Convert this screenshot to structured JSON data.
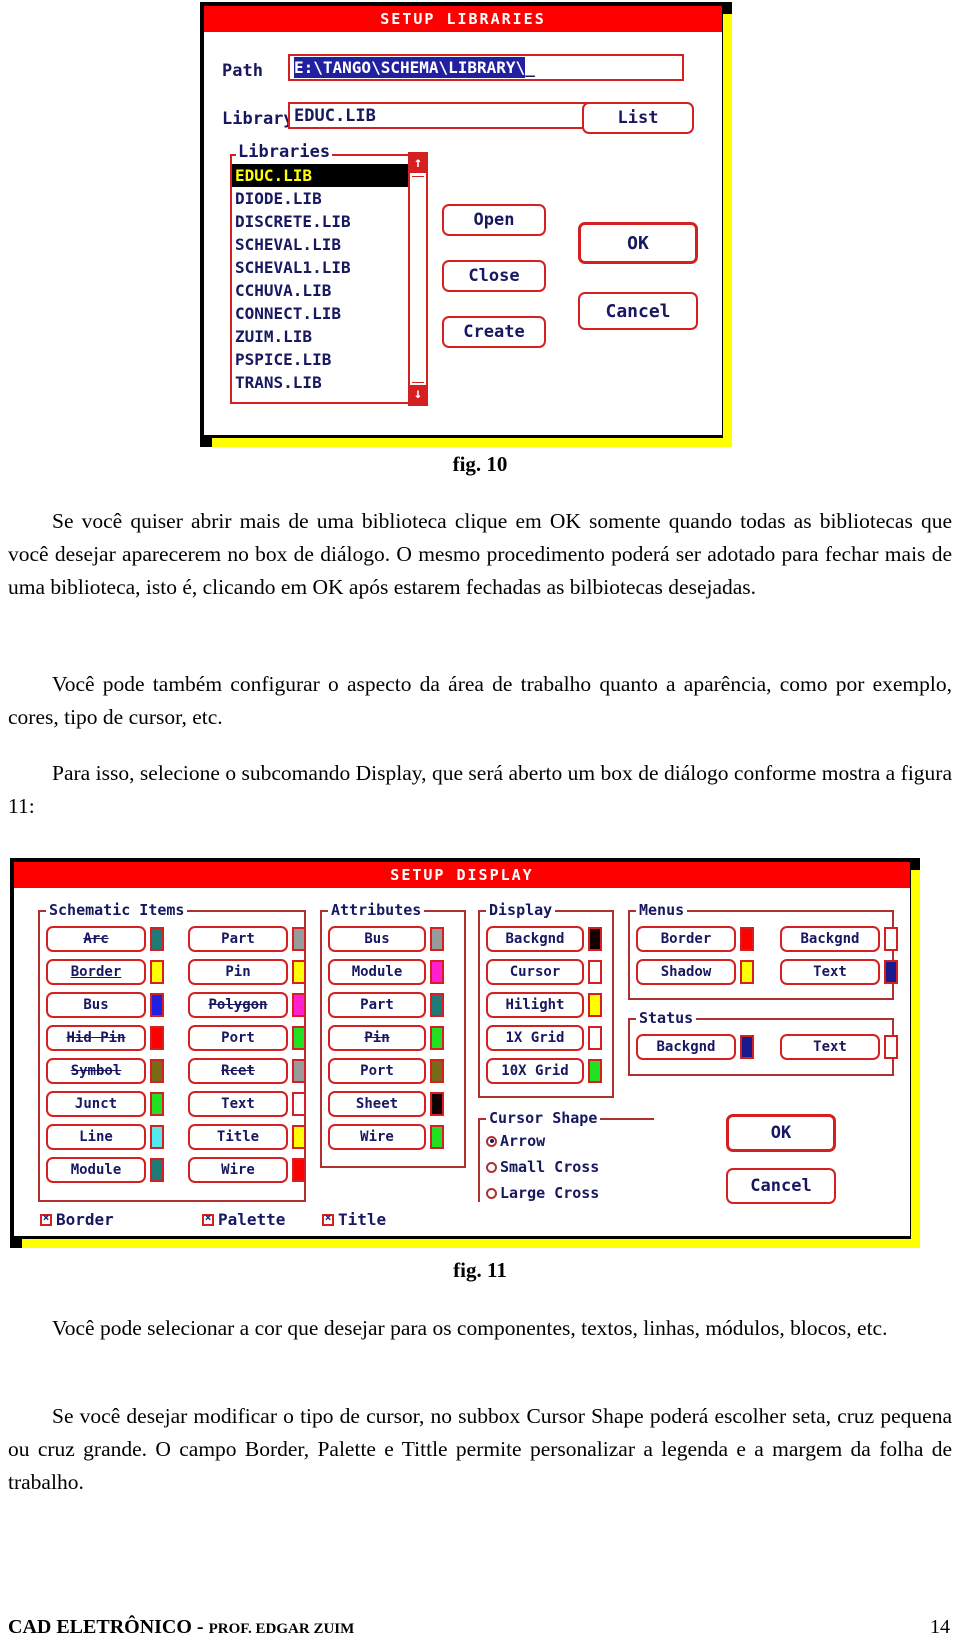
{
  "fig10": {
    "title": "SETUP LIBRARIES",
    "path_label": "Path",
    "path_value": "E:\\TANGO\\SCHEMA\\LIBRARY\\",
    "path_cursor": "_",
    "library_label": "Library",
    "library_value": "EDUC.LIB",
    "libraries_group": "Libraries",
    "libraries": [
      {
        "name": "EDUC.LIB",
        "selected": true
      },
      {
        "name": "DIODE.LIB",
        "selected": false
      },
      {
        "name": "DISCRETE.LIB",
        "selected": false
      },
      {
        "name": "SCHEVAL.LIB",
        "selected": false
      },
      {
        "name": "SCHEVAL1.LIB",
        "selected": false
      },
      {
        "name": "CCHUVA.LIB",
        "selected": false
      },
      {
        "name": "CONNECT.LIB",
        "selected": false
      },
      {
        "name": "ZUIM.LIB",
        "selected": false
      },
      {
        "name": "PSPICE.LIB",
        "selected": false
      },
      {
        "name": "TRANS.LIB",
        "selected": false
      }
    ],
    "scroll_up": "↑",
    "scroll_down": "↓",
    "list_button": "List",
    "open_button": "Open",
    "close_button": "Close",
    "create_button": "Create",
    "ok_button": "OK",
    "cancel_button": "Cancel",
    "caption": "fig. 10"
  },
  "fig11": {
    "title": "SETUP DISPLAY",
    "caption": "fig. 11",
    "schematic_items": {
      "group": "Schematic Items",
      "col1": [
        {
          "label": "Arc",
          "color": "#1f7a78",
          "style": "strike"
        },
        {
          "label": "Border",
          "color": "#ffff00",
          "style": "underline"
        },
        {
          "label": "Bus",
          "color": "#2020e0",
          "style": "none"
        },
        {
          "label": "Hid Pin",
          "color": "#ff0000",
          "style": "strike"
        },
        {
          "label": "Symbol",
          "color": "#7a6a18",
          "style": "strike"
        },
        {
          "label": "Junct",
          "color": "#22e022",
          "style": "none"
        },
        {
          "label": "Line",
          "color": "#55e8ee",
          "style": "none"
        },
        {
          "label": "Module",
          "color": "#1f7a78",
          "style": "none"
        }
      ],
      "col2": [
        {
          "label": "Part",
          "color": "#9a9a9a",
          "style": "none"
        },
        {
          "label": "Pin",
          "color": "#ffff00",
          "style": "none"
        },
        {
          "label": "Polygon",
          "color": "#ff20d0",
          "style": "strike"
        },
        {
          "label": "Port",
          "color": "#22e022",
          "style": "none"
        },
        {
          "label": "Rcet",
          "color": "#9a9a9a",
          "style": "strike"
        },
        {
          "label": "Text",
          "color": "#ffffff",
          "style": "none"
        },
        {
          "label": "Title",
          "color": "#ffff00",
          "style": "none"
        },
        {
          "label": "Wire",
          "color": "#ff0000",
          "style": "none"
        }
      ]
    },
    "attributes": {
      "group": "Attributes",
      "items": [
        {
          "label": "Bus",
          "color": "#9a9a9a",
          "style": "none"
        },
        {
          "label": "Module",
          "color": "#ff20d0",
          "style": "none"
        },
        {
          "label": "Part",
          "color": "#1f7a78",
          "style": "none"
        },
        {
          "label": "Pin",
          "color": "#22e022",
          "style": "strike"
        },
        {
          "label": "Port",
          "color": "#7a6a18",
          "style": "none"
        },
        {
          "label": "Sheet",
          "color": "#140000",
          "style": "none"
        },
        {
          "label": "Wire",
          "color": "#22e022",
          "style": "none"
        }
      ]
    },
    "display": {
      "group": "Display",
      "items": [
        {
          "label": "Backgnd",
          "color": "#140000"
        },
        {
          "label": "Cursor",
          "color": "#ffffff"
        },
        {
          "label": "Hilight",
          "color": "#ffff00"
        },
        {
          "label": "1X Grid",
          "color": "#ffffff"
        },
        {
          "label": "10X Grid",
          "color": "#22e022"
        }
      ]
    },
    "cursor_shape": {
      "group": "Cursor Shape",
      "options": [
        {
          "label": "Arrow",
          "selected": true
        },
        {
          "label": "Small Cross",
          "selected": false
        },
        {
          "label": "Large Cross",
          "selected": false
        }
      ]
    },
    "menus": {
      "group": "Menus",
      "items": [
        {
          "label": "Border",
          "color": "#ff0000"
        },
        {
          "label": "Backgnd",
          "color": "#ffffff"
        },
        {
          "label": "Shadow",
          "color": "#ffff00"
        },
        {
          "label": "Text",
          "color": "#1a1a8c"
        }
      ]
    },
    "status": {
      "group": "Status",
      "items": [
        {
          "label": "Backgnd",
          "color": "#1a1a8c"
        },
        {
          "label": "Text",
          "color": "#ffffff"
        }
      ]
    },
    "checkboxes": [
      {
        "label": "Border",
        "checked": true
      },
      {
        "label": "Palette",
        "checked": true
      },
      {
        "label": "Title",
        "checked": true
      }
    ],
    "ok_button": "OK",
    "cancel_button": "Cancel"
  },
  "body": {
    "p1": "Se você quiser abrir mais de uma biblioteca clique em OK somente quando todas as bibliotecas que você desejar aparecerem no box de diálogo. O mesmo procedimento poderá ser adotado para fechar mais de uma biblioteca, isto é, clicando em OK após estarem fechadas as bilbiotecas desejadas.",
    "p2": "Você pode também configurar o aspecto da área de trabalho quanto a aparência, como por exemplo, cores, tipo de cursor, etc.",
    "p3": "Para isso, selecione o subcomando Display, que será aberto um box de diálogo conforme mostra a figura 11:",
    "p4": "Você pode selecionar a cor que desejar para os componentes, textos, linhas, módulos, blocos, etc.",
    "p5": "Se você desejar modificar o tipo de cursor, no subbox Cursor Shape poderá escolher seta, cruz pequena ou cruz grande. O campo Border, Palette e Tittle permite personalizar a legenda e a margem da folha de trabalho."
  },
  "footer": {
    "course": "CAD ELETRÔNICO",
    "dash": " - ",
    "author": "PROF. EDGAR ZUIM",
    "page": "14"
  }
}
